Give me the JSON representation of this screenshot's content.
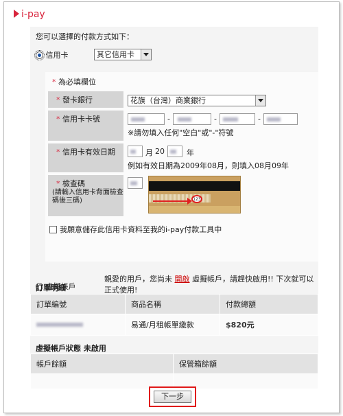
{
  "brand": "i-pay",
  "intro": "您可以選擇的付款方式如下：",
  "payment": {
    "credit_card_label": "信用卡",
    "card_type_selected": "其它信用卡",
    "required_note": "為必填欄位",
    "issuer_label": "發卡銀行",
    "issuer_value": "花旗（台灣）商業銀行",
    "card_number_label": "信用卡卡號",
    "card_number_hint": "※請勿填入任何\"空白\"或\"-\"符號",
    "expiry_label": "信用卡有效日期",
    "expiry_month_unit": "月",
    "expiry_year_prefix": "20",
    "expiry_year_unit": "年",
    "expiry_example": "例如有效日期為2009年08月，則填入08月09年",
    "cvv_label": "檢查碼",
    "cvv_sub": "(請輸入信用卡背面檢查碼後三碼)",
    "cvv_sample": "123",
    "save_card_label": "我願意儲存此信用卡資料至我的i-pay付款工具中"
  },
  "virtual": {
    "label": "虛擬帳戶",
    "msg_prefix": "親愛的用戶，您尚未",
    "msg_link": "開啟",
    "msg_suffix": "虛擬帳戶，請趕快啟用!! 下次就可以正式使用!"
  },
  "order": {
    "title": "訂單明細",
    "headers": [
      "訂單編號",
      "商品名稱",
      "付款總額"
    ],
    "product": "易通/月租帳單繳款",
    "amount": "$820元"
  },
  "virtual_status": {
    "title": "虛擬帳戶狀態 未啟用",
    "headers": [
      "帳戶餘額",
      "保管箱餘額"
    ]
  },
  "next_button": "下一步",
  "colors": {
    "brand_red": "#d8243c",
    "highlight_red": "#e01818"
  }
}
